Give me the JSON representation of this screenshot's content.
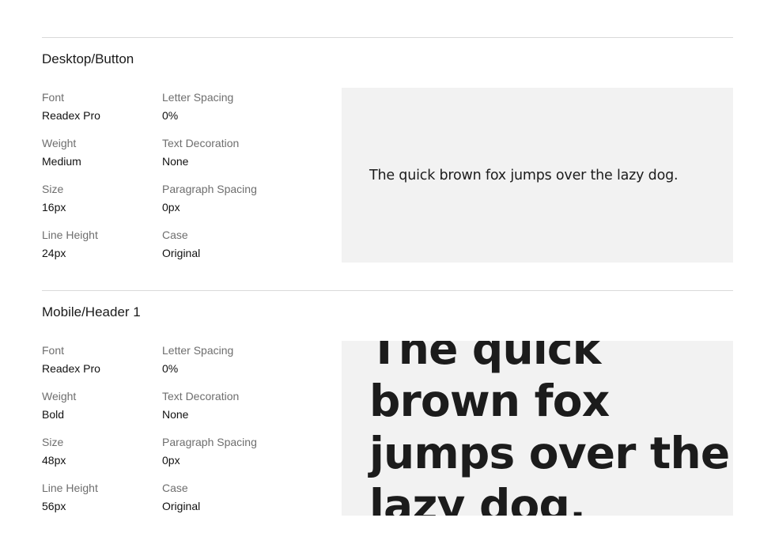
{
  "sections": [
    {
      "title": "Desktop/Button",
      "props": {
        "font": {
          "label": "Font",
          "value": "Readex Pro"
        },
        "letter_spacing": {
          "label": "Letter Spacing",
          "value": "0%"
        },
        "weight": {
          "label": "Weight",
          "value": "Medium"
        },
        "text_decoration": {
          "label": "Text Decoration",
          "value": "None"
        },
        "size": {
          "label": "Size",
          "value": "16px"
        },
        "paragraph_spacing": {
          "label": "Paragraph Spacing",
          "value": "0px"
        },
        "line_height": {
          "label": "Line Height",
          "value": "24px"
        },
        "case": {
          "label": "Case",
          "value": "Original"
        }
      },
      "sample": "The quick brown fox jumps over the lazy dog."
    },
    {
      "title": "Mobile/Header 1",
      "props": {
        "font": {
          "label": "Font",
          "value": "Readex Pro"
        },
        "letter_spacing": {
          "label": "Letter Spacing",
          "value": "0%"
        },
        "weight": {
          "label": "Weight",
          "value": "Bold"
        },
        "text_decoration": {
          "label": "Text Decoration",
          "value": "None"
        },
        "size": {
          "label": "Size",
          "value": "48px"
        },
        "paragraph_spacing": {
          "label": "Paragraph Spacing",
          "value": "0px"
        },
        "line_height": {
          "label": "Line Height",
          "value": "56px"
        },
        "case": {
          "label": "Case",
          "value": "Original"
        }
      },
      "sample": "The quick brown fox jumps over the lazy dog."
    }
  ],
  "colors": {
    "divider": "#d9d9d9",
    "label": "#6e6e6e",
    "preview_bg": "#f2f2f2",
    "text": "#111111"
  }
}
